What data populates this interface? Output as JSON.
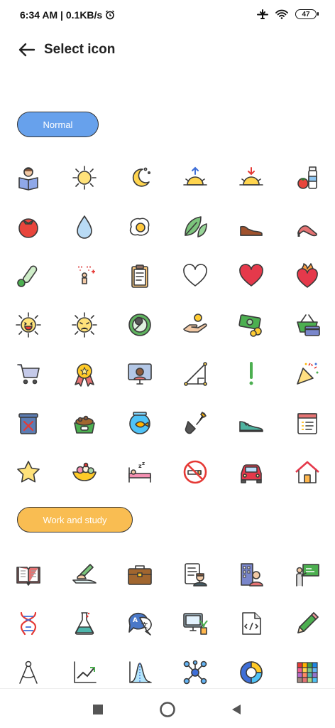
{
  "status_bar": {
    "time": "6:34 AM | 0.1KB/s",
    "battery": "47"
  },
  "header": {
    "title": "Select icon"
  },
  "sections": {
    "normal": {
      "label": "Normal"
    },
    "work": {
      "label": "Work and study"
    }
  },
  "icons": {
    "normal": [
      "reading-person-icon",
      "sun-icon",
      "moon-stars-icon",
      "sunrise-icon",
      "sunset-icon",
      "milk-tomato-icon",
      "tomato-icon",
      "water-drop-icon",
      "fried-egg-icon",
      "leaves-icon",
      "leather-shoe-icon",
      "high-heel-icon",
      "thermometer-icon",
      "shower-icon",
      "clipboard-icon",
      "heart-outline-icon",
      "heart-icon",
      "burning-heart-icon",
      "laughing-sun-icon",
      "sad-sun-icon",
      "wrench-icon",
      "coin-hand-icon",
      "money-icon",
      "shopping-basket-icon",
      "shopping-cart-icon",
      "medal-icon",
      "monitor-person-icon",
      "ruler-triangle-icon",
      "exclamation-icon",
      "party-popper-icon",
      "trash-can-icon",
      "pet-food-icon",
      "fishbowl-icon",
      "shovel-icon",
      "sneaker-icon",
      "notepad-icon",
      "star-icon",
      "dessert-icon",
      "sleeping-bed-icon",
      "no-smoking-icon",
      "car-icon",
      "house-icon"
    ],
    "work": [
      "open-book-icon",
      "writing-hand-icon",
      "briefcase-icon",
      "resume-icon",
      "office-building-icon",
      "teacher-board-icon",
      "dna-icon",
      "flask-icon",
      "translate-icon",
      "computer-plant-icon",
      "code-file-icon",
      "pencil-icon",
      "compass-icon",
      "line-chart-icon",
      "bell-curve-icon",
      "molecule-icon",
      "donut-chart-icon",
      "color-grid-icon"
    ]
  },
  "colors": {
    "normal_chip": "#67a1ec",
    "work_chip": "#f9bd52"
  }
}
